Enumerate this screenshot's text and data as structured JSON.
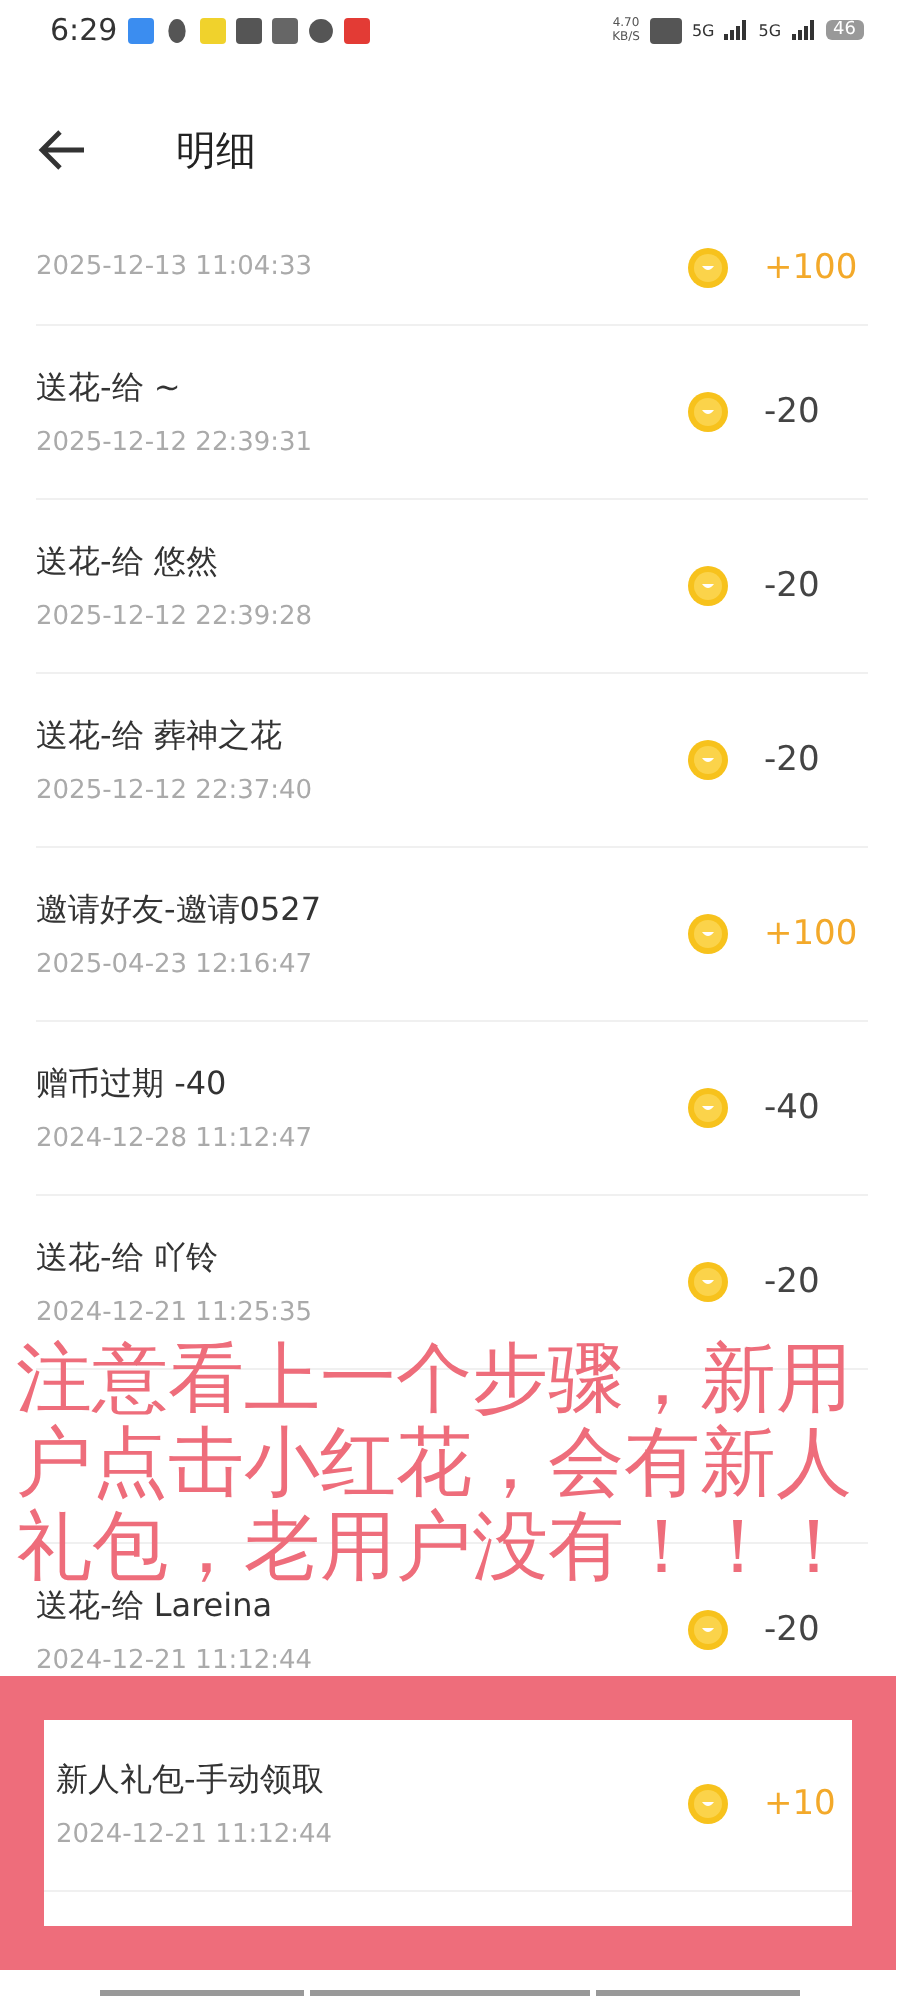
{
  "status_bar": {
    "time": "6:29",
    "net_speed": "4.70",
    "net_unit": "KB/S",
    "network_1": "5G",
    "network_2": "5G",
    "battery": "46"
  },
  "header": {
    "title": "明细"
  },
  "records": [
    {
      "date": "2025-12-13 11:04:33",
      "amount": "+100",
      "kind": "income"
    },
    {
      "title": "送花-给 ~",
      "date": "2025-12-12 22:39:31",
      "amount": "-20",
      "kind": "expense"
    },
    {
      "title": "送花-给 悠然",
      "date": "2025-12-12 22:39:28",
      "amount": "-20",
      "kind": "expense"
    },
    {
      "title": "送花-给 葬神之花",
      "date": "2025-12-12 22:37:40",
      "amount": "-20",
      "kind": "expense"
    },
    {
      "title": "邀请好友-邀请0527",
      "date": "2025-04-23 12:16:47",
      "amount": "+100",
      "kind": "income"
    },
    {
      "title": "赠币过期 -40",
      "date": "2024-12-28 11:12:47",
      "amount": "-40",
      "kind": "expense"
    },
    {
      "title": "送花-给 吖铃",
      "date": "2024-12-21 11:25:35",
      "amount": "-20",
      "kind": "expense"
    },
    {
      "kind": "covered"
    },
    {
      "title": "送花-给 Lareina",
      "date": "2024-12-21 11:12:44",
      "amount": "-20",
      "kind": "expense"
    },
    {
      "title": "新人礼包-手动领取",
      "date": "2024-12-21 11:12:44",
      "amount": "+10",
      "kind": "income"
    }
  ],
  "annotation": {
    "text": "注意看上一个步骤，新用户点击小红花，会有新人礼包，老用户没有！！！"
  }
}
